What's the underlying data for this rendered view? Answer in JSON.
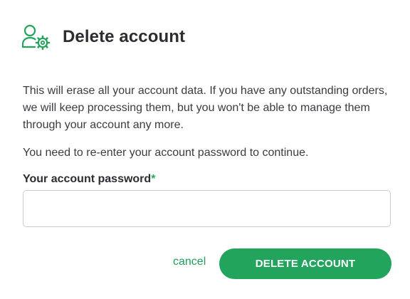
{
  "dialog": {
    "icon": "user-gear-icon",
    "title": "Delete account",
    "description": "This will erase all your account data. If you have any outstanding orders, we will keep processing them, but you won't be able to manage them through your account any more.",
    "instruction": "You need to re-enter your account password to continue.",
    "password_label": "Your account password",
    "required_mark": "*",
    "password_value": "",
    "cancel_label": "cancel",
    "delete_label": "DELETE ACCOUNT"
  },
  "colors": {
    "accent": "#22a45d",
    "text": "#2b2d31",
    "border": "#c9cdd1"
  }
}
